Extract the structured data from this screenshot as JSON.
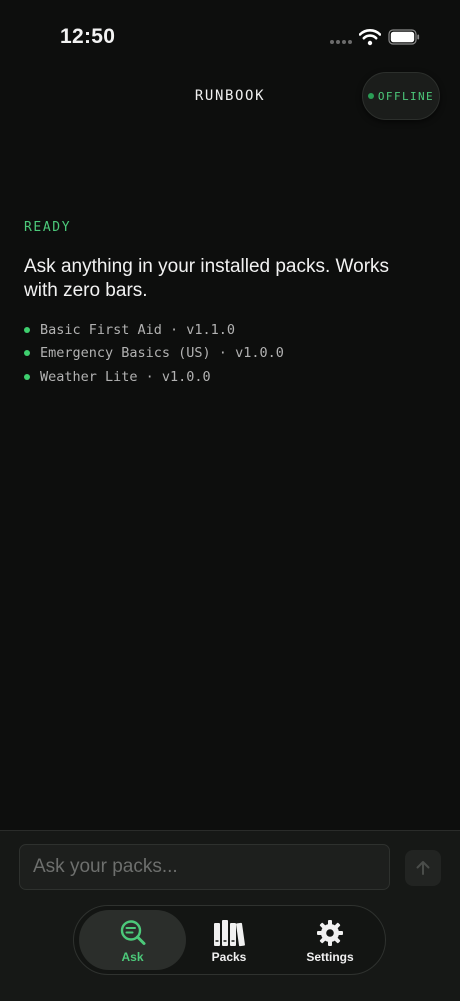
{
  "status_bar": {
    "time": "12:50"
  },
  "header": {
    "title": "RUNBOOK",
    "status_badge": "OFFLINE"
  },
  "main": {
    "status_label": "READY",
    "intro_text": "Ask anything in your installed packs. Works with zero bars.",
    "packs": [
      {
        "label": "Basic First Aid · v1.1.0"
      },
      {
        "label": "Emergency Basics (US) · v1.0.0"
      },
      {
        "label": "Weather Lite · v1.0.0"
      }
    ]
  },
  "composer": {
    "placeholder": "Ask your packs...",
    "value": ""
  },
  "tabs": [
    {
      "label": "Ask",
      "icon": "search-document-icon",
      "active": true
    },
    {
      "label": "Packs",
      "icon": "books-icon",
      "active": false
    },
    {
      "label": "Settings",
      "icon": "gear-icon",
      "active": false
    }
  ],
  "colors": {
    "accent": "#4cc97a",
    "background": "#0d0e0d"
  }
}
